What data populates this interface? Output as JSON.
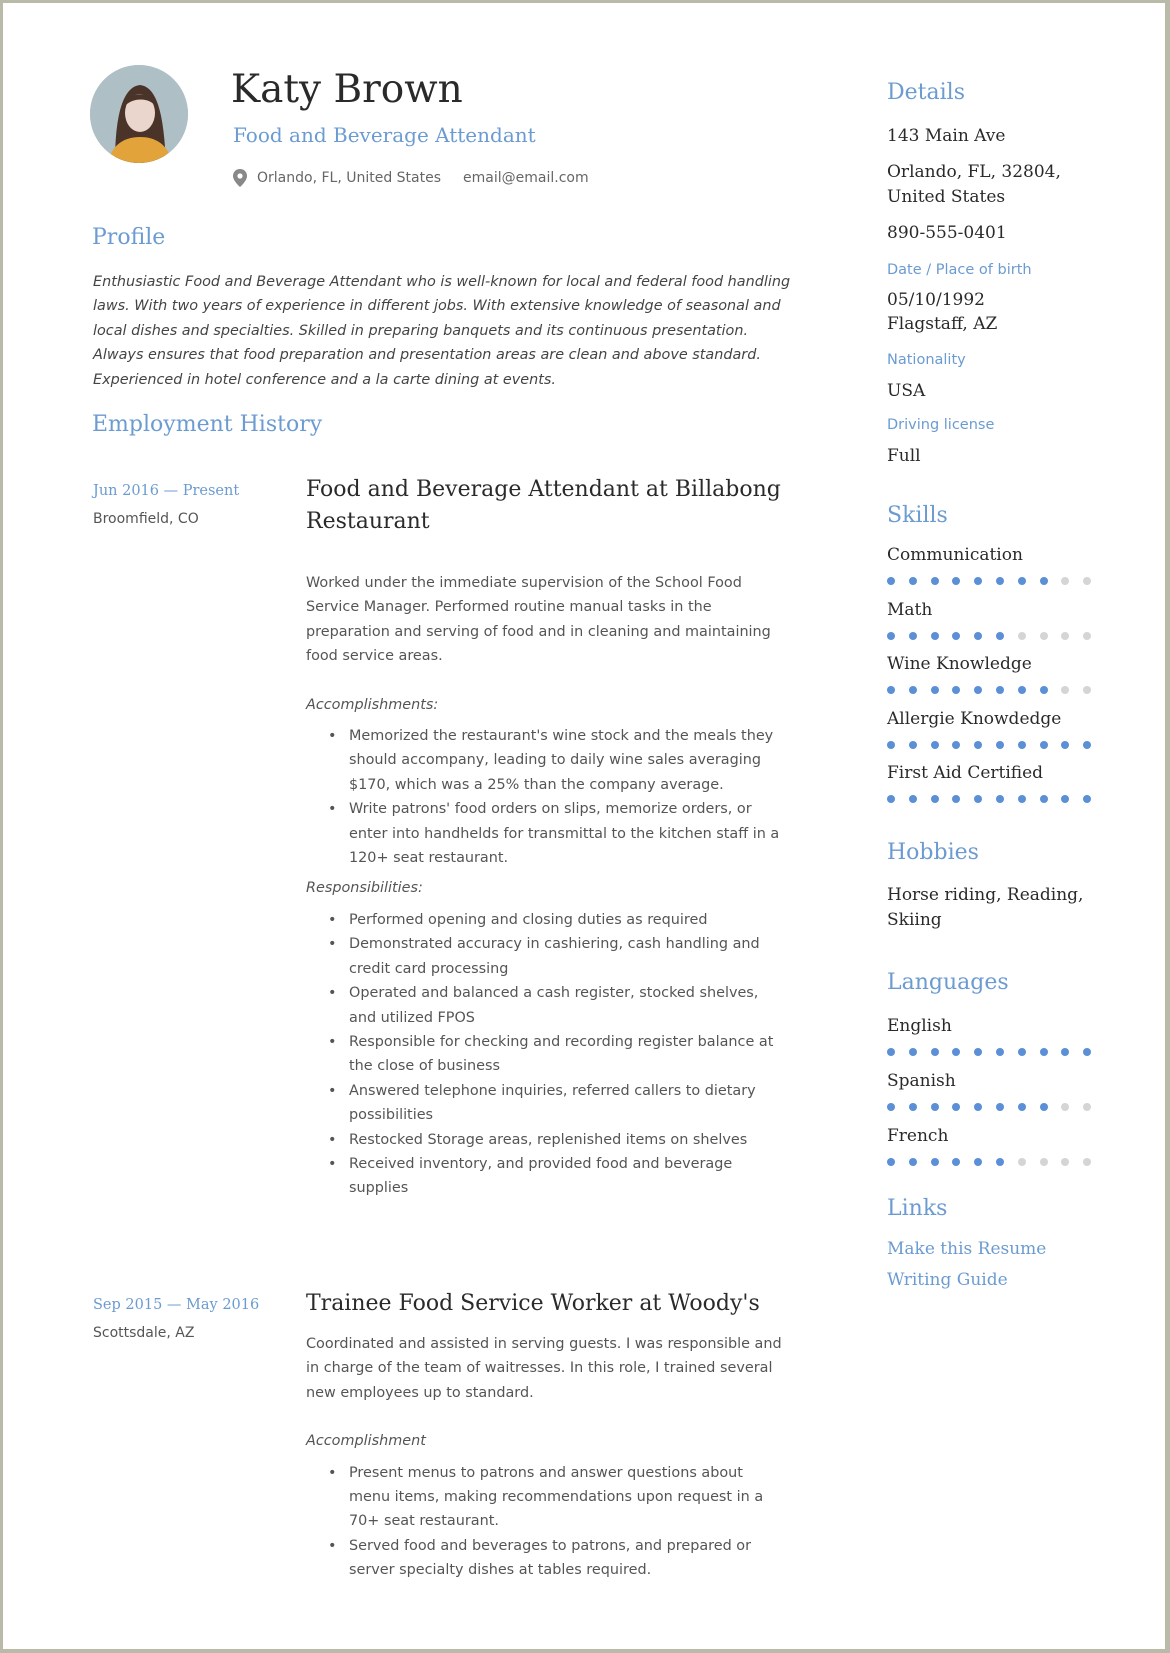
{
  "header": {
    "name": "Katy Brown",
    "job_title": "Food and Beverage Attendant",
    "location": "Orlando, FL, United States",
    "email": "email@email.com"
  },
  "profile": {
    "title": "Profile",
    "text": "Enthusiastic Food and Beverage Attendant who is well-known for local and federal food handling laws. With two years of experience in different jobs. With extensive knowledge of seasonal and local dishes and specialties. Skilled in preparing banquets and its continuous presentation. Always ensures that food preparation and presentation areas are clean and above standard. Experienced in hotel conference and a la carte dining at events."
  },
  "employment": {
    "title": "Employment History",
    "jobs": [
      {
        "dates": "Jun 2016 — Present",
        "location": "Broomfield, CO",
        "title": "Food and Beverage Attendant at  Billabong Restaurant",
        "summary": "Worked under the immediate supervision of the School Food Service Manager. Performed routine manual tasks in the preparation and serving of food and in cleaning and maintaining food service areas.",
        "accomplishments_label": "Accomplishments:",
        "accomplishments": [
          "Memorized the restaurant's wine stock and the meals they should accompany, leading to daily wine sales averaging $170, which was a 25% than the company average.",
          "Write patrons' food orders on slips, memorize orders, or enter into handhelds for transmittal to the kitchen staff in a 120+ seat restaurant."
        ],
        "responsibilities_label": "Responsibilities:",
        "responsibilities": [
          "Performed opening and closing duties as required",
          "Demonstrated accuracy in cashiering, cash handling and credit card processing",
          "Operated and balanced a cash register, stocked shelves, and utilized FPOS",
          "Responsible for checking and recording register balance at the close of business",
          "Answered telephone inquiries, referred callers to dietary possibilities",
          "Restocked Storage areas, replenished items on shelves",
          "Received inventory, and provided food and beverage supplies"
        ]
      },
      {
        "dates": "Sep 2015 — May 2016",
        "location": "Scottsdale, AZ",
        "title": "Trainee Food Service Worker at  Woody's",
        "summary": "Coordinated and assisted in serving guests. I was responsible and in charge of the team of waitresses. In this role, I trained several new employees up to standard.",
        "accomplishments_label": "Accomplishment",
        "accomplishments": [
          "Present menus to patrons and answer questions about menu items, making recommendations upon request in a 70+ seat restaurant.",
          "Served food and beverages to patrons, and prepared or server specialty dishes at tables required."
        ]
      }
    ]
  },
  "details": {
    "title": "Details",
    "address_line1": "143 Main Ave",
    "address_line2": "Orlando, FL, 32804, United States",
    "phone": "890-555-0401",
    "birth_label": "Date / Place of birth",
    "birth_date": "05/10/1992",
    "birth_place": "Flagstaff, AZ",
    "nationality_label": "Nationality",
    "nationality": "USA",
    "license_label": "Driving license",
    "license": "Full"
  },
  "skills": {
    "title": "Skills",
    "max_level": 10,
    "items": [
      {
        "name": "Communication",
        "level": 8
      },
      {
        "name": "Math",
        "level": 6
      },
      {
        "name": "Wine Knowledge",
        "level": 8
      },
      {
        "name": "Allergie Knowdedge",
        "level": 10
      },
      {
        "name": "First Aid Certified",
        "level": 10
      }
    ]
  },
  "hobbies": {
    "title": "Hobbies",
    "text": "Horse riding, Reading, Skiing"
  },
  "languages": {
    "title": "Languages",
    "max_level": 10,
    "items": [
      {
        "name": "English",
        "level": 10
      },
      {
        "name": "Spanish",
        "level": 8
      },
      {
        "name": "French",
        "level": 6
      }
    ]
  },
  "links": {
    "title": "Links",
    "items": [
      "Make this Resume",
      "Writing Guide"
    ]
  },
  "icons": {
    "location": "map-pin-icon"
  },
  "colors": {
    "accent": "#6b9bd1",
    "dot_on": "#5b8fd6",
    "dot_off": "#d5d5d5",
    "text": "#2a2a2a"
  }
}
